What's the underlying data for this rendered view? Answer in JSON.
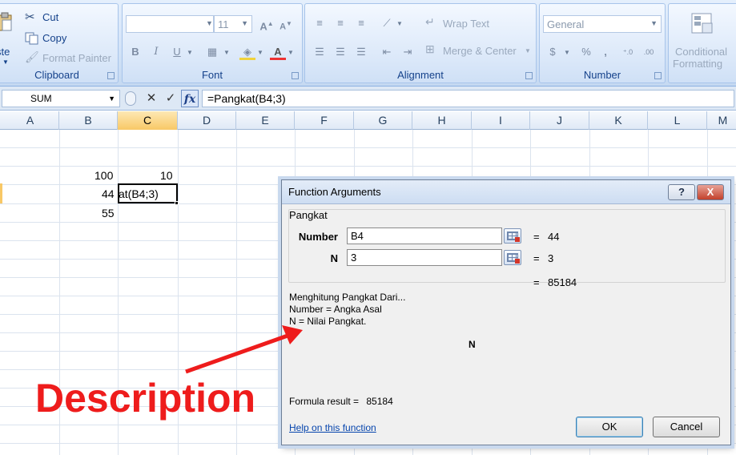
{
  "ribbon": {
    "clipboard": {
      "paste_label": "ste",
      "cut_label": "Cut",
      "copy_label": "Copy",
      "format_painter_label": "Format Painter",
      "group_label": "Clipboard"
    },
    "font": {
      "font_name": "",
      "font_size": "11",
      "group_label": "Font"
    },
    "alignment": {
      "wrap_text_label": "Wrap Text",
      "merge_center_label": "Merge & Center",
      "group_label": "Alignment"
    },
    "number": {
      "format_value": "General",
      "group_label": "Number"
    },
    "styles": {
      "conditional_formatting_line1": "Conditional",
      "conditional_formatting_line2": "Formatting"
    }
  },
  "formula_bar": {
    "name_box": "SUM",
    "formula": "=Pangkat(B4;3)"
  },
  "grid": {
    "columns": [
      "A",
      "B",
      "C",
      "D",
      "E",
      "F",
      "G",
      "H",
      "I",
      "J",
      "K",
      "L",
      "M"
    ],
    "active_column": "C",
    "cells": {
      "b3": "100",
      "c3": "10",
      "b4": "44",
      "c4_edit": "at(B4;3)",
      "b5": "55"
    }
  },
  "dialog": {
    "title": "Function Arguments",
    "help_button": "?",
    "close_button": "X",
    "function_name": "Pangkat",
    "args": [
      {
        "label": "Number",
        "value": "B4",
        "result": "44"
      },
      {
        "label": "N",
        "value": "3",
        "result": "3"
      }
    ],
    "equals_sign": "=",
    "overall_result": "85184",
    "description_lines": [
      "Menghitung Pangkat Dari...",
      "Number = Angka Asal",
      "N = Nilai Pangkat."
    ],
    "focused_argument": "N",
    "formula_result_label": "Formula result =",
    "formula_result_value": "85184",
    "help_link": "Help on this function",
    "ok_label": "OK",
    "cancel_label": "Cancel"
  },
  "annotation": {
    "text": "Description",
    "color": "#ee1c1c"
  },
  "colors": {
    "ribbon_text": "#15428b",
    "active_header": "#f8c866",
    "annotation": "#ee1c1c"
  }
}
